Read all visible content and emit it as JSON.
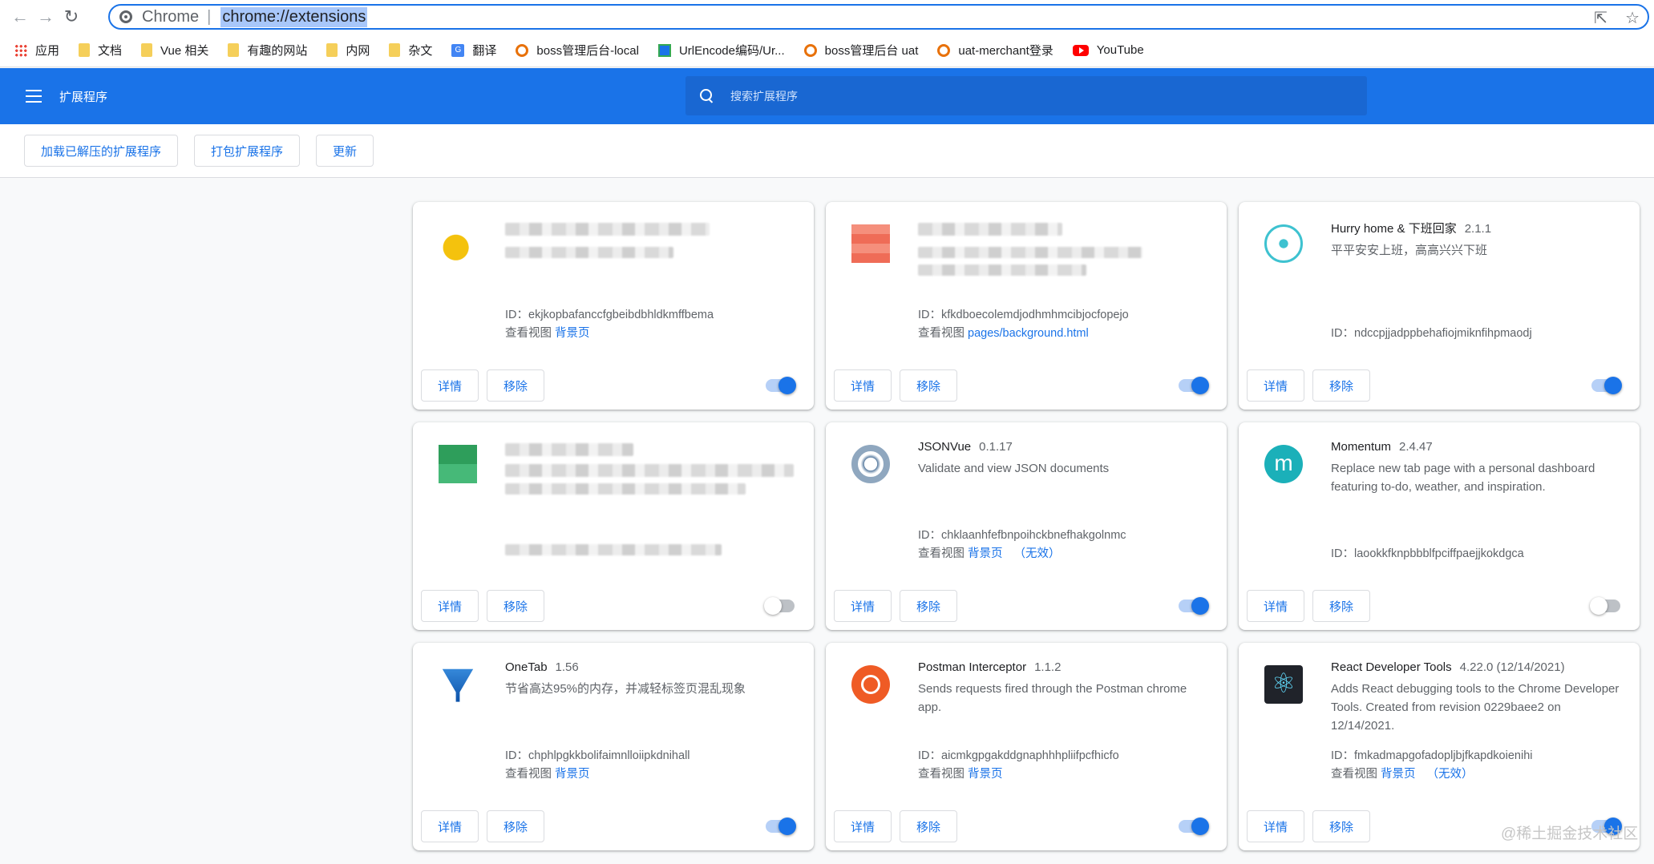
{
  "browser": {
    "tab_site": "Chrome",
    "url": "chrome://extensions"
  },
  "bookmarks": [
    {
      "label": "应用",
      "icon": "apps-grid-icon"
    },
    {
      "label": "文档",
      "icon": "folder-icon"
    },
    {
      "label": "Vue 相关",
      "icon": "folder-icon"
    },
    {
      "label": "有趣的网站",
      "icon": "folder-icon"
    },
    {
      "label": "内网",
      "icon": "folder-icon"
    },
    {
      "label": "杂文",
      "icon": "folder-icon"
    },
    {
      "label": "翻译",
      "icon": "translate-icon"
    },
    {
      "label": "boss管理后台-local",
      "icon": "boss-icon"
    },
    {
      "label": "UrlEncode编码/Ur...",
      "icon": "urlencode-icon"
    },
    {
      "label": "boss管理后台 uat",
      "icon": "boss-icon"
    },
    {
      "label": "uat-merchant登录",
      "icon": "boss-icon"
    },
    {
      "label": "YouTube",
      "icon": "youtube-icon"
    }
  ],
  "header": {
    "title": "扩展程序",
    "search_placeholder": "搜索扩展程序"
  },
  "dev_buttons": {
    "load_unpacked": "加载已解压的扩展程序",
    "pack": "打包扩展程序",
    "update": "更新"
  },
  "labels": {
    "details": "详情",
    "remove": "移除",
    "id_prefix": "ID：",
    "inspect_views": "查看视图",
    "inactive": "（无效）"
  },
  "extensions": [
    {
      "name": "",
      "version": "",
      "description": "",
      "id": "ekjkopbafanccfgbeibdbhldkmffbema",
      "view": "背景页",
      "inactive": false,
      "enabled": true,
      "icon": "yellow-bird-icon",
      "blurred": true
    },
    {
      "name": "",
      "version": "",
      "description": "",
      "id": "kfkdboecolemdjodhmhmcibjocfopejo",
      "view": "pages/background.html",
      "inactive": false,
      "enabled": true,
      "icon": "red-tile-icon",
      "blurred": true
    },
    {
      "name": "Hurry home & 下班回家",
      "version": "2.1.1",
      "description": "平平安安上班，高高兴兴下班",
      "id": "ndccpjjadppbehafiojmiknfihpmaodj",
      "view": "",
      "inactive": false,
      "enabled": true,
      "icon": "clock-icon",
      "blurred": false
    },
    {
      "name": "",
      "version": "",
      "description": "",
      "id": "",
      "view": "",
      "inactive": false,
      "enabled": false,
      "icon": "green-tile-icon",
      "blurred": true
    },
    {
      "name": "JSONVue",
      "version": "0.1.17",
      "description": "Validate and view JSON documents",
      "id": "chklaanhfefbnpoihckbnefhakgolnmc",
      "view": "背景页",
      "inactive": true,
      "enabled": true,
      "icon": "jsonvue-icon",
      "blurred": false
    },
    {
      "name": "Momentum",
      "version": "2.4.47",
      "description": "Replace new tab page with a personal dashboard featuring to-do, weather, and inspiration.",
      "id": "laookkfknpbbblfpciffpaejjkokdgca",
      "view": "",
      "inactive": false,
      "enabled": false,
      "icon": "momentum-icon",
      "blurred": false
    },
    {
      "name": "OneTab",
      "version": "1.56",
      "description": "节省高达95%的内存，并减轻标签页混乱现象",
      "id": "chphlpgkkbolifaimnlloiipkdnihall",
      "view": "背景页",
      "inactive": false,
      "enabled": true,
      "icon": "onetab-funnel-icon",
      "blurred": false
    },
    {
      "name": "Postman Interceptor",
      "version": "1.1.2",
      "description": "Sends requests fired through the Postman chrome app.",
      "id": "aicmkgpgakddgnaphhhpliifpcfhicfo",
      "view": "背景页",
      "inactive": false,
      "enabled": true,
      "icon": "postman-icon",
      "blurred": false
    },
    {
      "name": "React Developer Tools",
      "version": "4.22.0 (12/14/2021)",
      "description": "Adds React debugging tools to the Chrome Developer Tools. Created from revision 0229baee2 on 12/14/2021.",
      "id": "fmkadmapgofadopljbjfkapdkoienihi",
      "view": "背景页",
      "inactive": true,
      "enabled": true,
      "icon": "react-icon",
      "blurred": false
    }
  ],
  "watermark": "@稀土掘金技术社区"
}
